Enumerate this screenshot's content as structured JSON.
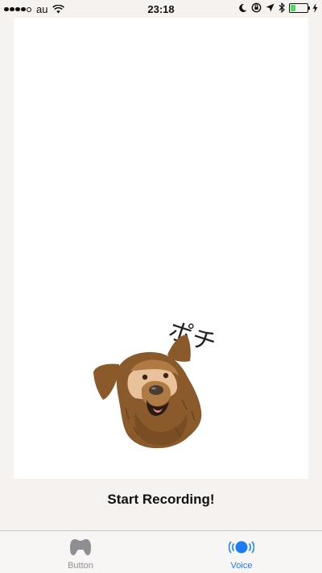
{
  "status_bar": {
    "carrier": "au",
    "time": "23:18",
    "signal_bars_filled": 4,
    "signal_bars_total": 5,
    "battery_level": 0.3,
    "icons": [
      "wifi-icon",
      "moon-icon",
      "rotation-lock-icon",
      "location-arrow-icon",
      "bluetooth-icon",
      "battery-icon",
      "charging-bolt-icon"
    ]
  },
  "canvas": {
    "dog_name": "ポチ",
    "avatar": "dog-face-illustration"
  },
  "record": {
    "label": "Start Recording!"
  },
  "tabs": [
    {
      "label": "Button",
      "icon": "gamepad-icon",
      "selected": false,
      "color": "#8e8e93"
    },
    {
      "label": "Voice",
      "icon": "voice-wave-icon",
      "selected": true,
      "color": "#1e7cf2"
    }
  ],
  "colors": {
    "background": "#f6f2ef",
    "card": "#ffffff",
    "accent": "#1e7cf2",
    "fur_dark": "#8a5a2b",
    "fur_light": "#b07a45",
    "battery": "#4cd964"
  }
}
